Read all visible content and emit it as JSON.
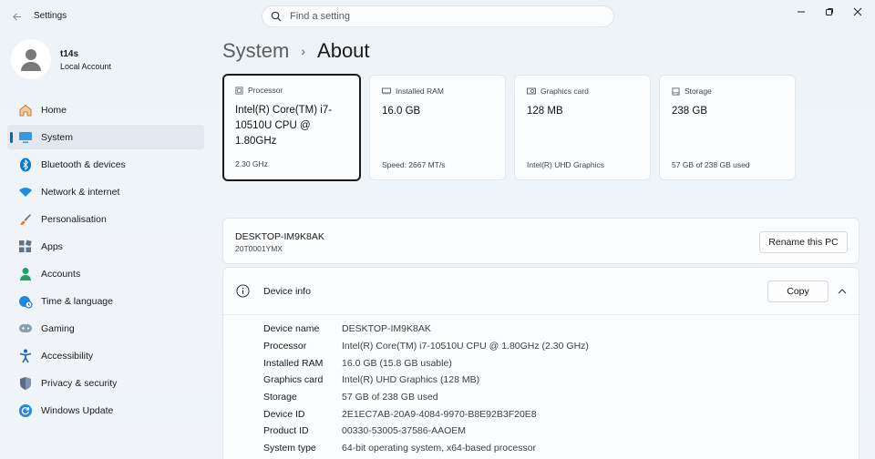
{
  "window": {
    "app_title": "Settings",
    "icons": {
      "back": "back-arrow-icon",
      "minimize": "minimize-icon",
      "maximize": "maximize-icon",
      "close": "close-icon"
    }
  },
  "search": {
    "placeholder": "Find a setting",
    "value": ""
  },
  "profile": {
    "name": "t14s",
    "account_type": "Local Account"
  },
  "nav": {
    "items": [
      {
        "label": "Home",
        "icon": "home-icon",
        "active": false
      },
      {
        "label": "System",
        "icon": "system-icon",
        "active": true
      },
      {
        "label": "Bluetooth & devices",
        "icon": "bluetooth-icon",
        "active": false
      },
      {
        "label": "Network & internet",
        "icon": "wifi-icon",
        "active": false
      },
      {
        "label": "Personalisation",
        "icon": "brush-icon",
        "active": false
      },
      {
        "label": "Apps",
        "icon": "apps-icon",
        "active": false
      },
      {
        "label": "Accounts",
        "icon": "accounts-icon",
        "active": false
      },
      {
        "label": "Time & language",
        "icon": "globe-clock-icon",
        "active": false
      },
      {
        "label": "Gaming",
        "icon": "gamepad-icon",
        "active": false
      },
      {
        "label": "Accessibility",
        "icon": "accessibility-icon",
        "active": false
      },
      {
        "label": "Privacy & security",
        "icon": "shield-icon",
        "active": false
      },
      {
        "label": "Windows Update",
        "icon": "update-icon",
        "active": false
      }
    ]
  },
  "breadcrumb": {
    "parent": "System",
    "separator": "›",
    "current": "About"
  },
  "cards": [
    {
      "label": "Processor",
      "value": "Intel(R) Core(TM) i7-10510U CPU @ 1.80GHz",
      "sub": "2.30 GHz",
      "icon": "processor-icon"
    },
    {
      "label": "Installed RAM",
      "value": "16.0 GB",
      "sub": "Speed: 2667 MT/s",
      "icon": "ram-icon"
    },
    {
      "label": "Graphics card",
      "value": "128 MB",
      "sub": "Intel(R) UHD Graphics",
      "icon": "graphics-card-icon"
    },
    {
      "label": "Storage",
      "value": "238 GB",
      "sub": "57 GB of 238 GB used",
      "icon": "storage-icon"
    }
  ],
  "pc": {
    "name": "DESKTOP-IM9K8AK",
    "model": "20T0001YMX",
    "rename_label": "Rename this PC"
  },
  "device_info": {
    "title": "Device info",
    "copy_label": "Copy",
    "specs": [
      {
        "label": "Device name",
        "value": "DESKTOP-IM9K8AK"
      },
      {
        "label": "Processor",
        "value": "Intel(R) Core(TM) i7-10510U CPU @ 1.80GHz (2.30 GHz)"
      },
      {
        "label": "Installed RAM",
        "value": "16.0 GB (15.8 GB usable)"
      },
      {
        "label": "Graphics card",
        "value": "Intel(R) UHD Graphics (128 MB)"
      },
      {
        "label": "Storage",
        "value": "57 GB of 238 GB used"
      },
      {
        "label": "Device ID",
        "value": "2E1EC7AB-20A9-4084-9970-B8E92B3F20E8"
      },
      {
        "label": "Product ID",
        "value": "00330-53005-37586-AAOEM"
      },
      {
        "label": "System type",
        "value": "64-bit operating system, x64-based processor"
      }
    ]
  },
  "colors": {
    "accent": "#0067c0",
    "bluetooth": "#0078d4",
    "shield": "#5a6b85"
  }
}
